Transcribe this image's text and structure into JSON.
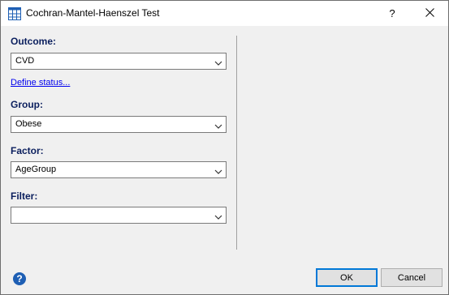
{
  "window": {
    "title": "Cochran-Mantel-Haenszel Test",
    "help_glyph": "?",
    "app_icon": "table-chart-icon",
    "close_icon": "close-icon"
  },
  "form": {
    "outcome_label": "Outcome:",
    "outcome_value": "CVD",
    "define_status_link": "Define status...",
    "group_label": "Group:",
    "group_value": "Obese",
    "factor_label": "Factor:",
    "factor_value": "AgeGroup",
    "filter_label": "Filter:",
    "filter_value": ""
  },
  "footer": {
    "help_glyph": "?",
    "ok_label": "OK",
    "cancel_label": "Cancel"
  },
  "colors": {
    "label_color": "#0b1f5e",
    "link_color": "#0000ee",
    "default_button_border": "#0078d7",
    "help_icon_bg": "#1e5fb4"
  }
}
